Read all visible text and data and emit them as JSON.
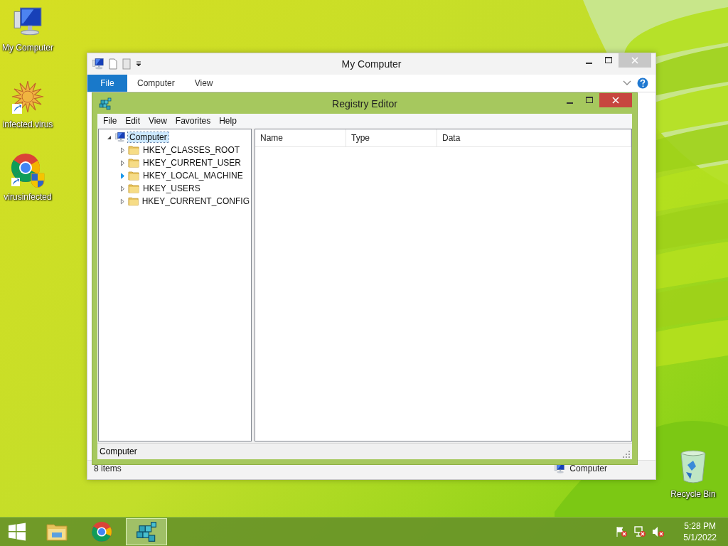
{
  "desktop_icons": [
    {
      "label": "My Computer",
      "kind": "computer"
    },
    {
      "label": "infected.virus",
      "kind": "star"
    },
    {
      "label": "virusinfected",
      "kind": "chrome"
    }
  ],
  "recycle_bin": {
    "label": "Recycle Bin"
  },
  "explorer": {
    "title": "My Computer",
    "ribbon_tabs": [
      {
        "label": "File",
        "selected": true
      },
      {
        "label": "Computer",
        "selected": false
      },
      {
        "label": "View",
        "selected": false
      }
    ],
    "status_bar": {
      "item_count": "8 items",
      "location": "Computer"
    }
  },
  "registry_editor": {
    "title": "Registry Editor",
    "menu": [
      "File",
      "Edit",
      "View",
      "Favorites",
      "Help"
    ],
    "tree": {
      "label": "Computer",
      "expanded": true,
      "selected": true,
      "children": [
        {
          "label": "HKEY_CLASSES_ROOT",
          "expanded": false,
          "hovered": false
        },
        {
          "label": "HKEY_CURRENT_USER",
          "expanded": false,
          "hovered": false
        },
        {
          "label": "HKEY_LOCAL_MACHINE",
          "expanded": false,
          "hovered": true
        },
        {
          "label": "HKEY_USERS",
          "expanded": false,
          "hovered": false
        },
        {
          "label": "HKEY_CURRENT_CONFIG",
          "expanded": false,
          "hovered": false
        }
      ]
    },
    "columns": [
      "Name",
      "Type",
      "Data"
    ],
    "status_bar": "Computer"
  },
  "taskbar": {
    "apps": [
      {
        "kind": "explorer",
        "selected": false
      },
      {
        "kind": "chrome",
        "selected": false
      },
      {
        "kind": "regedit",
        "selected": true
      }
    ],
    "time": "5:28 PM",
    "date": "5/1/2022"
  }
}
